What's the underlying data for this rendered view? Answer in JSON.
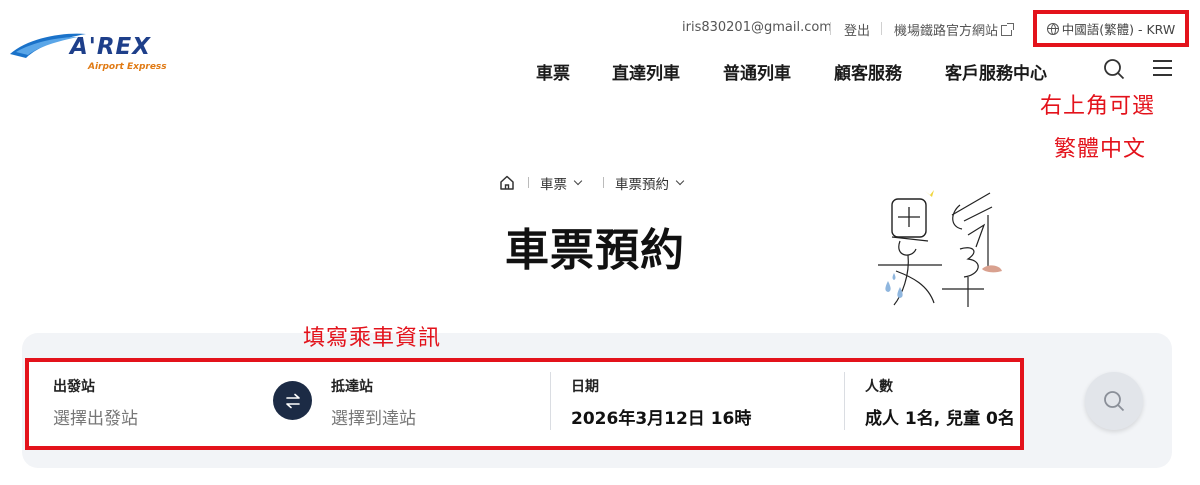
{
  "brand": {
    "logo_word": "A'REX",
    "logo_sub": "Airport Express",
    "colors": {
      "navy": "#1e3f8a",
      "orange": "#e07a14",
      "blue_swoosh": "#1a72c9"
    }
  },
  "utility": {
    "email": "iris830201@gmail.com",
    "logout": "登出",
    "official_site": "機場鐵路官方網站",
    "language": "中國語(繁體) - KRW"
  },
  "nav": {
    "items": [
      "車票",
      "直達列車",
      "普通列車",
      "顧客服務",
      "客戶服務中心"
    ],
    "icons": [
      "search-icon",
      "hamburger-menu-icon"
    ]
  },
  "annotations": {
    "top_right_line1": "右上角可選",
    "top_right_line2": "繁體中文",
    "form_note": "填寫乘車資訊",
    "color": "#e3121b"
  },
  "breadcrumb": {
    "home_icon": "home-icon",
    "level1": "車票",
    "level2": "車票預約"
  },
  "page": {
    "title": "車票預約"
  },
  "booking": {
    "departure": {
      "label": "出發站",
      "placeholder": "選擇出發站"
    },
    "arrival": {
      "label": "抵達站",
      "placeholder": "選擇到達站"
    },
    "date": {
      "label": "日期",
      "value": "2026年3月12日 16時"
    },
    "passengers": {
      "label": "人數",
      "value": "成人 1名, 兒童 0名"
    },
    "swap_icon": "swap-arrows-icon",
    "search_icon": "search-icon"
  }
}
